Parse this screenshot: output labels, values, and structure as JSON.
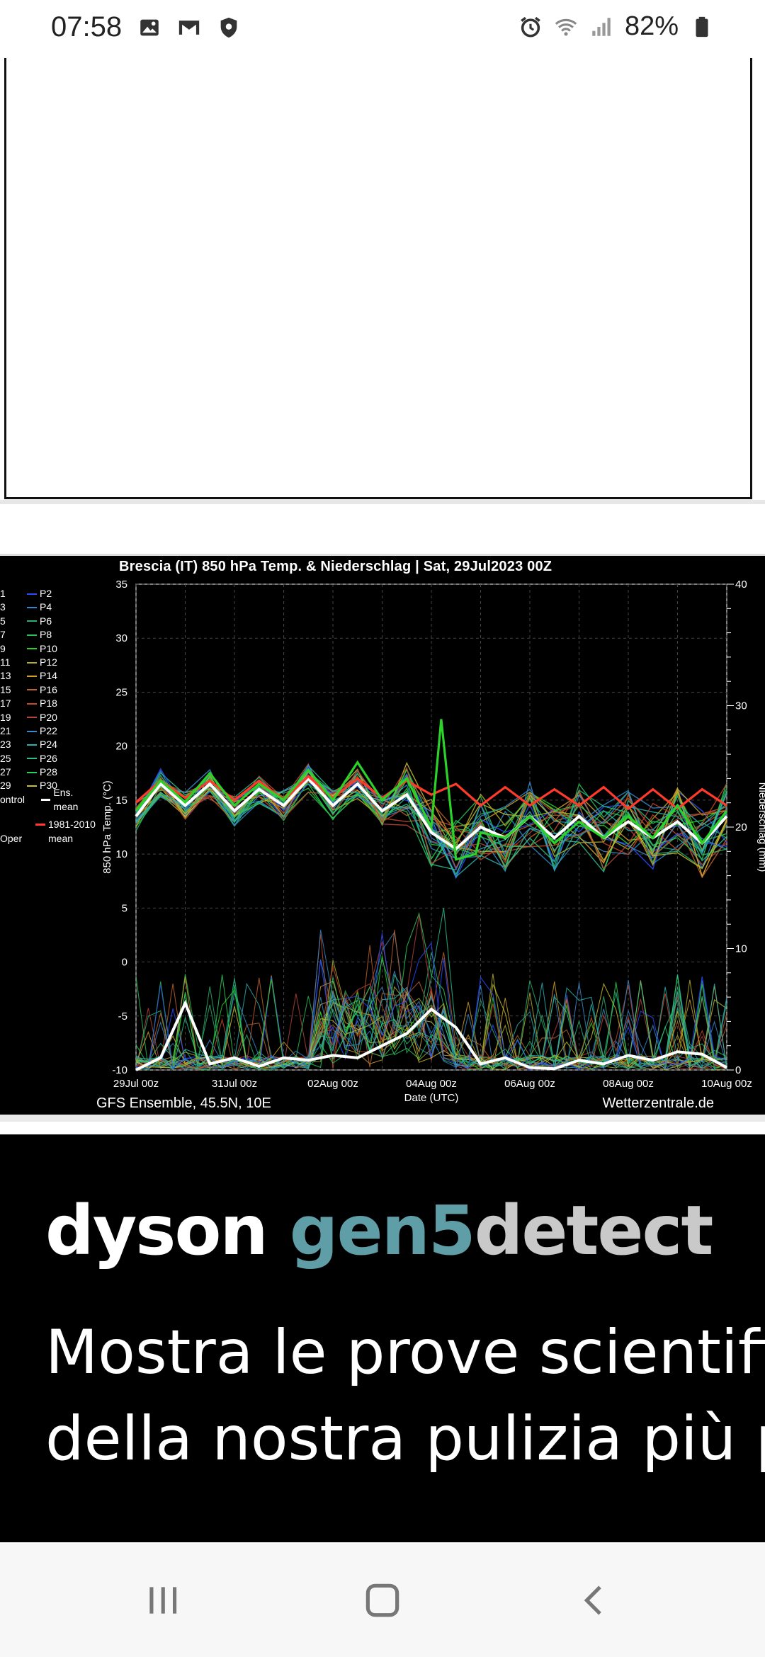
{
  "status_bar": {
    "time": "07:58",
    "left_icons": [
      "image-icon",
      "gmail-icon",
      "shield-icon"
    ],
    "right_icons": [
      "alarm-icon",
      "wifi-icon",
      "signal-icon",
      "battery-icon"
    ],
    "battery": "82%"
  },
  "chart": {
    "title": "Brescia  (IT)  850 hPa Temp. & Niederschlag | Sat, 29Jul2023 00Z",
    "footer_left": "GFS Ensemble, 45.5N, 10E",
    "footer_right": "Wetterzentrale.de",
    "legend": [
      {
        "num": "1",
        "name": "P2",
        "color": "#2a4cff"
      },
      {
        "num": "3",
        "name": "P4",
        "color": "#2f8ac9"
      },
      {
        "num": "5",
        "name": "P6",
        "color": "#2cb070"
      },
      {
        "num": "7",
        "name": "P8",
        "color": "#28c05a"
      },
      {
        "num": "9",
        "name": "P10",
        "color": "#2ad22a"
      },
      {
        "num": "11",
        "name": "P12",
        "color": "#b4b02a"
      },
      {
        "num": "13",
        "name": "P14",
        "color": "#d1a32a"
      },
      {
        "num": "15",
        "name": "P16",
        "color": "#c0632a"
      },
      {
        "num": "17",
        "name": "P18",
        "color": "#c54a2a"
      },
      {
        "num": "19",
        "name": "P20",
        "color": "#b5453a"
      },
      {
        "num": "21",
        "name": "P22",
        "color": "#3a8acb"
      },
      {
        "num": "23",
        "name": "P24",
        "color": "#2ab0b0"
      },
      {
        "num": "25",
        "name": "P26",
        "color": "#2ac08a"
      },
      {
        "num": "27",
        "name": "P28",
        "color": "#2ad05a"
      },
      {
        "num": "29",
        "name": "P30",
        "color": "#c8c02a"
      }
    ],
    "legend_extra": {
      "control": "ontrol",
      "ens_mean": "Ens. mean",
      "clim": "1981-2010",
      "clim2": "mean",
      "oper": "Oper"
    },
    "chart_data": {
      "type": "line",
      "xlabel": "Date (UTC)",
      "ylabel": "850 hPa Temp. (°C)",
      "y2label": "Niederschlag (mm)",
      "ylim": [
        -10,
        35
      ],
      "y2lim": [
        0,
        40
      ],
      "yticks": [
        -10,
        -5,
        0,
        5,
        10,
        15,
        20,
        25,
        30,
        35
      ],
      "y2ticks": [
        0,
        10,
        20,
        30,
        40
      ],
      "x_tick_labels": [
        "29Jul 00z",
        "31Jul 00z",
        "02Aug 00z",
        "04Aug 00z",
        "06Aug 00z",
        "08Aug 00z",
        "10Aug 00z"
      ],
      "grid": true,
      "series": [
        {
          "name": "Ens. mean",
          "color": "#ffffff",
          "x_days": [
            0,
            0.5,
            1,
            1.5,
            2,
            2.5,
            3,
            3.5,
            4,
            4.5,
            5,
            5.5,
            6,
            6.5,
            7,
            7.5,
            8,
            8.5,
            9,
            9.5,
            10,
            10.5,
            11,
            11.5,
            12
          ],
          "values": [
            13.5,
            16.5,
            14.5,
            16.5,
            14,
            16,
            14.5,
            17,
            14.5,
            16.5,
            14,
            15.5,
            12,
            10.5,
            12.5,
            11.5,
            13.5,
            11.5,
            13.5,
            11.5,
            13,
            11.5,
            13,
            11,
            13.5
          ]
        },
        {
          "name": "1981-2010 mean",
          "color": "#ff3a2a",
          "x_days": [
            0,
            0.5,
            1,
            1.5,
            2,
            2.5,
            3,
            3.5,
            4,
            4.5,
            5,
            5.5,
            6,
            6.5,
            7,
            7.5,
            8,
            8.5,
            9,
            9.5,
            10,
            10.5,
            11,
            11.5,
            12
          ],
          "values": [
            14.8,
            16.8,
            15.2,
            16.8,
            15,
            16.8,
            15,
            17.2,
            15.2,
            17,
            15.2,
            16.8,
            15.5,
            16.5,
            14.5,
            16.2,
            14.5,
            16,
            14.5,
            16.2,
            14.2,
            16,
            14.2,
            16,
            14.5
          ]
        },
        {
          "name": "P10",
          "color": "#2ad22a",
          "x_days": [
            0,
            0.5,
            1,
            1.5,
            2,
            2.5,
            3,
            3.5,
            4,
            4.5,
            5,
            5.5,
            6,
            6.2,
            6.5,
            6.9,
            7,
            7.5,
            8,
            8.5,
            9,
            9.5,
            10,
            10.5,
            11,
            11.5,
            12
          ],
          "values": [
            14,
            16.8,
            14.8,
            17.5,
            14.5,
            16.5,
            15,
            17.8,
            15,
            18.5,
            15,
            17,
            12.5,
            22.5,
            9.5,
            10,
            12,
            11.5,
            13.5,
            11,
            13,
            11.5,
            13.5,
            11.5,
            14.5,
            11,
            14
          ]
        },
        {
          "name": "Ens. mean precip",
          "color": "#ffffff",
          "axis": "y2",
          "x_days": [
            0,
            0.5,
            1,
            1.5,
            2,
            2.5,
            3,
            3.5,
            4,
            4.5,
            5,
            5.5,
            6,
            6.5,
            7,
            7.5,
            8,
            8.5,
            9,
            9.5,
            10,
            10.5,
            11,
            11.5,
            12
          ],
          "values": [
            0,
            1,
            5.5,
            0.5,
            1,
            0.3,
            1,
            0.8,
            1.2,
            1,
            2,
            3,
            5,
            3.5,
            0.5,
            1,
            0.2,
            0.1,
            0.8,
            0.5,
            1.2,
            0.8,
            1.5,
            1.3,
            0.2
          ]
        }
      ]
    }
  },
  "ad": {
    "brand_dyson": "dyson",
    "brand_gen5": "gen5",
    "brand_detect": "detect",
    "line1": "Mostra le prove scientifiche",
    "line2": "della nostra pulizia più profonda"
  },
  "nav": {
    "icons": [
      "recent-apps-icon",
      "home-icon",
      "back-icon"
    ]
  }
}
